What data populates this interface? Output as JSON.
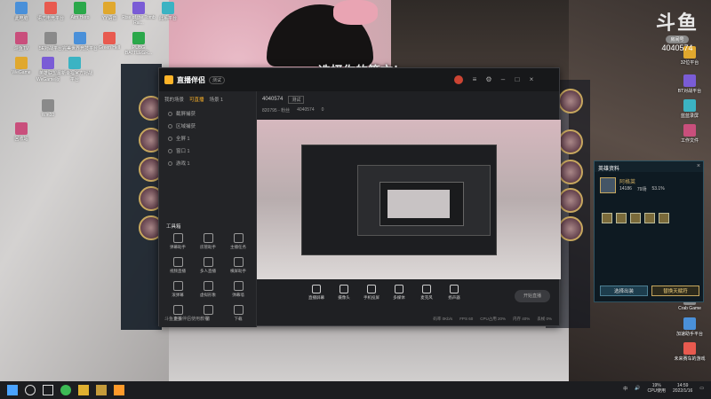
{
  "desktop": {
    "icons_left": [
      {
        "label": "此电脑"
      },
      {
        "label": "语方电竞平台"
      },
      {
        "label": "Aim Hero"
      },
      {
        "label": "YY语音"
      },
      {
        "label": "Rise of the Tomb Rai..."
      },
      {
        "label": "此系平台"
      },
      {
        "label": "斗鱼TV"
      },
      {
        "label": "5E对战平台"
      },
      {
        "label": "完美世界竞技平台"
      },
      {
        "label": "Green Hell"
      },
      {
        "label": "PUBG BATTLEGR..."
      },
      {
        "label": "WeGame"
      },
      {
        "label": "英雄联盟WeGame版"
      },
      {
        "label": "最新幸福官方对战平台"
      },
      {
        "label": "回收站"
      },
      {
        "label": "Win10"
      }
    ],
    "icons_right": [
      {
        "label": "32位平台"
      },
      {
        "label": "BT对战平台"
      },
      {
        "label": "蓝蓝录屏"
      },
      {
        "label": "工作文件"
      },
      {
        "label": "Crab Game"
      },
      {
        "label": "加速助手平台"
      },
      {
        "label": "未来赛车的游戏"
      }
    ]
  },
  "logo": {
    "text": "斗鱼",
    "pill": "房间号",
    "room": "4040574"
  },
  "overlay_title": "选择你的符文！",
  "app": {
    "name": "直播伴侣",
    "version": "测试",
    "tabs": [
      "我的场景",
      "可直播",
      "场景 1"
    ],
    "scenes": [
      "截屏捕获",
      "区域捕获",
      "全屏 1",
      "窗口 1",
      "游戏 1"
    ],
    "room_id": "4040574",
    "room_tag": "测试",
    "room_meta": [
      "820795 - 粉丝",
      "4040574",
      "0"
    ],
    "tools_title": "工具箱",
    "tools": [
      {
        "label": "弹幕助手"
      },
      {
        "label": "房管助手"
      },
      {
        "label": "主播任务"
      },
      {
        "label": "视频直播"
      },
      {
        "label": "多人直播"
      },
      {
        "label": "横屏助手"
      },
      {
        "label": "滚弹幕"
      },
      {
        "label": "虚拟形象"
      },
      {
        "label": "弹幕墙"
      },
      {
        "label": "更多"
      },
      {
        "label": "新"
      },
      {
        "label": "下载"
      }
    ],
    "side_footer": "斗鱼直播伴侣使用教程",
    "controls": [
      {
        "label": "直播屏幕"
      },
      {
        "label": "摄像头"
      },
      {
        "label": "手机投屏"
      },
      {
        "label": "多媒体"
      },
      {
        "label": "麦克风"
      },
      {
        "label": "扬声器"
      }
    ],
    "go_live": "开始直播",
    "status": [
      "码率 0Kb/s",
      "FPS 60",
      "CPU占用 20%",
      "内存 40%",
      "丢帧 0%"
    ]
  },
  "card": {
    "title": "英雄资料",
    "player": "阿格莱",
    "stats": [
      "14186",
      "79场",
      "53.1%"
    ],
    "buttons": [
      "选择出装",
      "替换天赋符"
    ]
  },
  "taskbar": {
    "tray_lang": "中",
    "cpu": "19%",
    "cpu_label": "CPU使用",
    "time": "14:59",
    "date": "2022/1/16"
  }
}
